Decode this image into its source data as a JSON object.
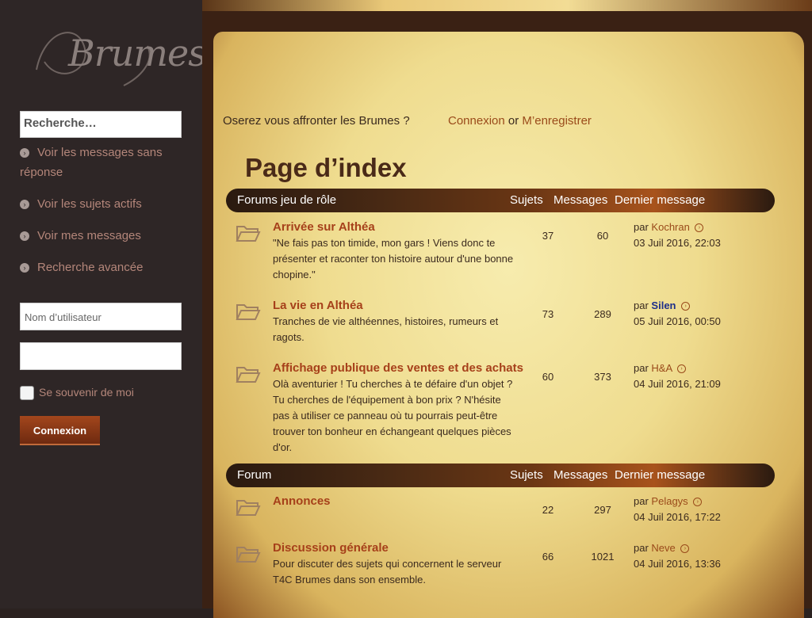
{
  "sidebar": {
    "logo_text": "Brumes",
    "search_placeholder": "Recherche…",
    "links": [
      {
        "label": "Voir les messages sans réponse"
      },
      {
        "label": "Voir les sujets actifs"
      },
      {
        "label": "Voir mes messages"
      },
      {
        "label": "Recherche avancée"
      }
    ],
    "username_placeholder": "Nom d’utilisateur",
    "password_placeholder": "",
    "remember_label": "Se souvenir de moi",
    "login_button": "Connexion"
  },
  "header": {
    "tagline": "Oserez vous affronter les Brumes ?",
    "login_link": "Connexion",
    "or_text": "or",
    "register_link": "M’enregistrer",
    "page_title": "Page d’index"
  },
  "columns": {
    "topics": "Sujets",
    "posts": "Messages",
    "last": "Dernier message"
  },
  "categories": [
    {
      "name": "Forums jeu de rôle",
      "forums": [
        {
          "title": "Arrivée sur Althéa",
          "desc": "\"Ne fais pas ton timide, mon gars ! Viens donc te présenter et raconter ton histoire autour d'une bonne chopine.\"",
          "topics": "37",
          "posts": "60",
          "by": "par",
          "user": "Kochran",
          "date": "03 Juil 2016, 22:03"
        },
        {
          "title": "La vie en Althéa",
          "desc": "Tranches de vie althéennes, histoires, rumeurs et ragots.",
          "topics": "73",
          "posts": "289",
          "by": "par",
          "user": "Silen",
          "date": "05 Juil 2016, 00:50"
        },
        {
          "title": "Affichage publique des ventes et des achats",
          "desc": "Olà aventurier ! Tu cherches à te défaire d'un objet ? Tu cherches de l'équipement à bon prix ? N'hésite pas à utiliser ce panneau où tu pourrais peut-être trouver ton bonheur en échangeant quelques pièces d'or.",
          "topics": "60",
          "posts": "373",
          "by": "par",
          "user": "H&A",
          "date": "04 Juil 2016, 21:09"
        }
      ]
    },
    {
      "name": "Forum",
      "forums": [
        {
          "title": "Annonces",
          "desc": "",
          "topics": "22",
          "posts": "297",
          "by": "par",
          "user": "Pelagys",
          "date": "04 Juil 2016, 17:22"
        },
        {
          "title": "Discussion générale",
          "desc": "Pour discuter des sujets qui concernent le serveur T4C Brumes dans son ensemble.",
          "topics": "66",
          "posts": "1021",
          "by": "par",
          "user": "Neve",
          "date": "04 Juil 2016, 13:36"
        }
      ]
    }
  ]
}
